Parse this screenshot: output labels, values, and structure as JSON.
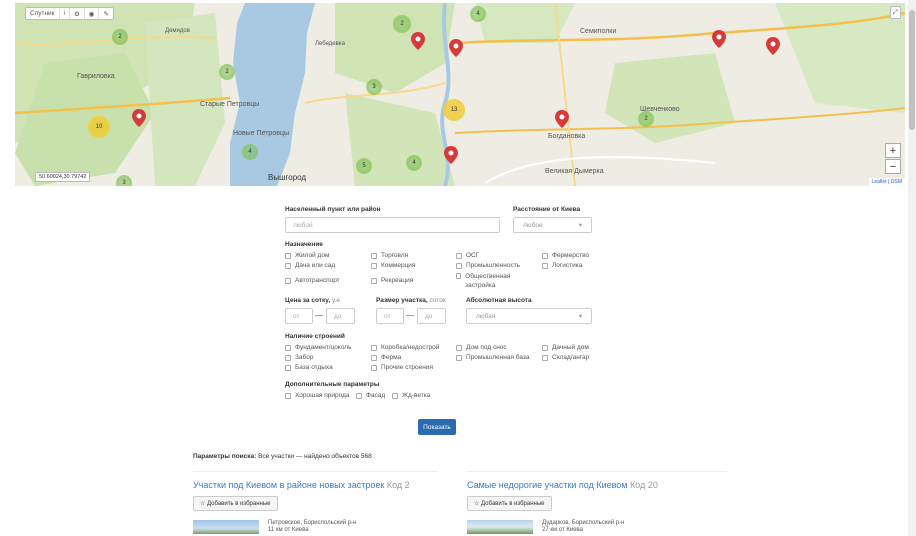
{
  "map": {
    "toolbar": {
      "layer_label": "Спутник",
      "info_icon": "i"
    },
    "labels": {
      "demidov": "Демидов",
      "demidova": "Демидова",
      "gavrilovka": "Гавриловка",
      "starye_petrovtsy": "Старые Петровцы",
      "novye_petrovtsy": "Новые Петровцы",
      "vyshgorod": "Вышгород",
      "semipolki": "Семиполки",
      "shevchenkovo": "Шевченково",
      "bogdanovka": "Богдановка",
      "velikaya_dymerka": "Великая Дымерка",
      "lebedevka": "Лебедевка",
      "gornostaypol": "Горностайполь"
    },
    "clusters": [
      {
        "id": "c1",
        "count": "2",
        "color": "green"
      },
      {
        "id": "c2",
        "count": "2",
        "color": "green"
      },
      {
        "id": "c3",
        "count": "4",
        "color": "green"
      },
      {
        "id": "c4",
        "count": "3",
        "color": "green"
      },
      {
        "id": "c5",
        "count": "2",
        "color": "green"
      },
      {
        "id": "c6",
        "count": "13",
        "color": "yellow"
      },
      {
        "id": "c7",
        "count": "10",
        "color": "yellow"
      },
      {
        "id": "c8",
        "count": "4",
        "color": "green"
      },
      {
        "id": "c9",
        "count": "5",
        "color": "green"
      },
      {
        "id": "c10",
        "count": "4",
        "color": "green"
      },
      {
        "id": "c11",
        "count": "2",
        "color": "green"
      },
      {
        "id": "c12",
        "count": "3",
        "color": "green"
      }
    ],
    "zoom_in": "+",
    "zoom_out": "−",
    "coords": "50.60024,30.79742",
    "attribution": "Leaflet | OSM"
  },
  "form": {
    "locality_label": "Населенный пункт или район",
    "locality_placeholder": "любой",
    "distance_label": "Расстояние от Киева",
    "distance_value": "любое",
    "purpose_label": "Назначение",
    "purpose_options": [
      "Жилой дом",
      "Торговля",
      "ОСГ",
      "Фермерство",
      "Дача или сад",
      "Коммерция",
      "Промышленность",
      "Логистика",
      "Автотранспорт",
      "Рекреация",
      "Общественная застройка"
    ],
    "price_label": "Цена за сотку,",
    "price_unit": "у.е",
    "size_label": "Размер участка,",
    "size_unit": "соток",
    "from_placeholder": "от",
    "to_placeholder": "до",
    "height_label": "Абсолютная высота",
    "height_value": "любая",
    "buildings_label": "Наличие строений",
    "buildings_options": [
      "Фундамент/цоколь",
      "Коробка/недострой",
      "Дом под снос",
      "Дачный дом",
      "Забор",
      "Ферма",
      "Промышленная база",
      "Склад/ангар",
      "База отдыха",
      "Прочие строения"
    ],
    "extra_label": "Дополнительные параметры",
    "extra_options": [
      "Хорошая природа",
      "Фасад",
      "Жд-ветка"
    ],
    "submit": "Показать"
  },
  "results": {
    "summary_bold": "Параметры поиска:",
    "summary_text": "Все участки — найдено объектов 568",
    "left": {
      "title": "Участки под Киевом в районе новых застроек",
      "code": "Код 2",
      "fav": "☆ Добавить в избранные",
      "location": "Петровское, Бориспольский р-н",
      "distance": "11 км от Киева"
    },
    "right": {
      "title": "Самые недорогие участки под Киевом",
      "code": "Код 20",
      "fav": "☆ Добавить в избранные",
      "location": "Дударков, Бориспольский р-н",
      "distance": "27 км от Киева"
    }
  }
}
